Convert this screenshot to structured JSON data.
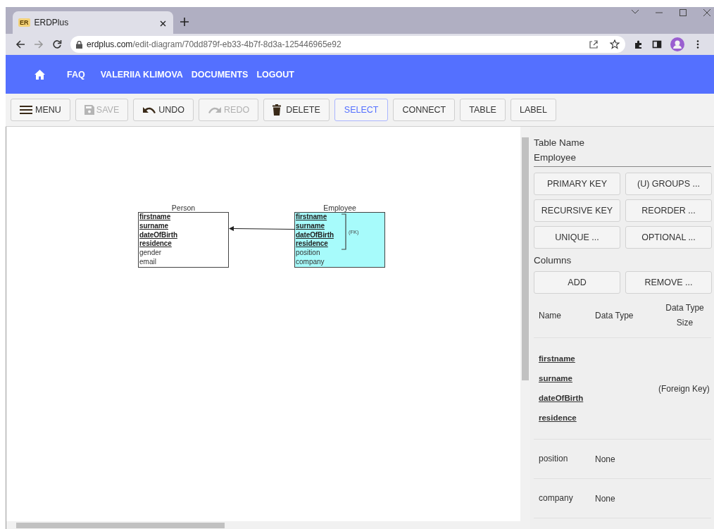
{
  "browser": {
    "tab_icon": "ER",
    "tab_title": "ERDPlus",
    "url_host": "erdplus.com",
    "url_path": "/edit-diagram/70dd879f-eb33-4b7f-8d3a-125446965e92"
  },
  "nav": {
    "items": [
      "FAQ",
      "VALERIIA KLIMOVA",
      "DOCUMENTS",
      "LOGOUT"
    ]
  },
  "toolbar": [
    {
      "label": "MENU",
      "kind": "menu",
      "disabled": false,
      "selected": false
    },
    {
      "label": "SAVE",
      "kind": "save",
      "disabled": true,
      "selected": false
    },
    {
      "label": "UNDO",
      "kind": "undo",
      "disabled": false,
      "selected": false
    },
    {
      "label": "REDO",
      "kind": "redo",
      "disabled": true,
      "selected": false
    },
    {
      "label": "DELETE",
      "kind": "trash",
      "disabled": false,
      "selected": false
    },
    {
      "label": "SELECT",
      "kind": "text",
      "disabled": false,
      "selected": true
    },
    {
      "label": "CONNECT",
      "kind": "text",
      "disabled": false,
      "selected": false
    },
    {
      "label": "TABLE",
      "kind": "text",
      "disabled": false,
      "selected": false
    },
    {
      "label": "LABEL",
      "kind": "text",
      "disabled": false,
      "selected": false
    }
  ],
  "diagram": {
    "tables": [
      {
        "name": "Person",
        "selected": false,
        "columns": [
          {
            "name": "firstname",
            "key": true
          },
          {
            "name": "surname",
            "key": true
          },
          {
            "name": "dateOfBirth",
            "key": true
          },
          {
            "name": "residence",
            "key": true
          },
          {
            "name": "gender",
            "key": false
          },
          {
            "name": "email",
            "key": false
          }
        ]
      },
      {
        "name": "Employee",
        "selected": true,
        "fk_label": "(FK)",
        "columns": [
          {
            "name": "firstname",
            "key": true
          },
          {
            "name": "surname",
            "key": true
          },
          {
            "name": "dateOfBirth",
            "key": true
          },
          {
            "name": "residence",
            "key": true
          },
          {
            "name": "position",
            "key": false
          },
          {
            "name": "company",
            "key": false
          }
        ]
      }
    ]
  },
  "panel": {
    "table_name_label": "Table Name",
    "table_name": "Employee",
    "key_buttons": [
      "PRIMARY KEY",
      "(U) GROUPS ...",
      "RECURSIVE KEY",
      "REORDER ...",
      "UNIQUE ...",
      "OPTIONAL ..."
    ],
    "columns_label": "Columns",
    "column_buttons": [
      "ADD",
      "REMOVE ..."
    ],
    "headers": [
      "Name",
      "Data Type",
      "Data Type Size"
    ],
    "rows": [
      {
        "names": [
          "firstname",
          "surname",
          "dateOfBirth",
          "residence"
        ],
        "key": true,
        "note": "(Foreign Key)"
      },
      {
        "names": [
          "position"
        ],
        "key": false,
        "data_type": "None"
      },
      {
        "names": [
          "company"
        ],
        "key": false,
        "data_type": "None"
      }
    ]
  }
}
